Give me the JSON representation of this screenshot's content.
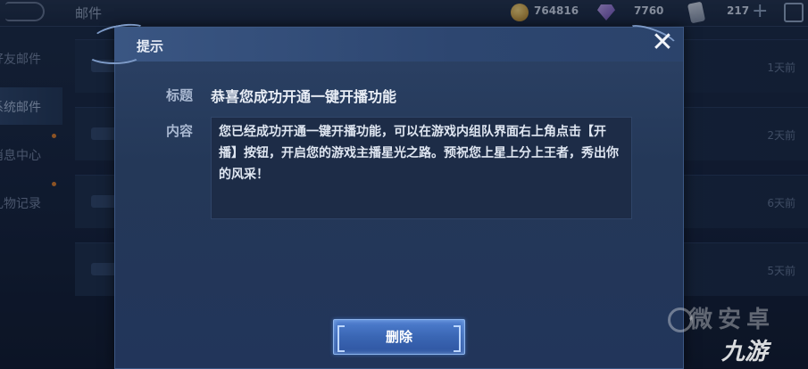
{
  "topbar": {
    "page_title": "邮件",
    "gold": "764816",
    "diamond": "7760",
    "vouchers": "217",
    "gold_icon": "gold-coin-icon",
    "diamond_icon": "purple-gem-icon",
    "voucher_icon": "card-voucher-icon"
  },
  "sidebar": {
    "items": [
      {
        "label": "好友邮件"
      },
      {
        "label": "系统邮件"
      },
      {
        "label": "消息中心"
      },
      {
        "label": "礼物记录"
      }
    ]
  },
  "mail_list": {
    "rows": [
      {
        "age": "1天前"
      },
      {
        "age": "2天前"
      },
      {
        "age": "6天前"
      },
      {
        "age": "5天前"
      }
    ]
  },
  "dialog": {
    "title": "提示",
    "subject_label": "标题",
    "subject": "恭喜您成功开通一键开播功能",
    "content_label": "内容",
    "content": "您已经成功开通一键开播功能，可以在游戏内组队界面右上角点击【开播】按钮，开启您的游戏主播星光之路。预祝您上星上分上王者，秀出你的风采！",
    "delete_label": "删除",
    "close_icon": "close-icon"
  },
  "watermark": {
    "line1": "微安卓",
    "line2": "九游"
  }
}
